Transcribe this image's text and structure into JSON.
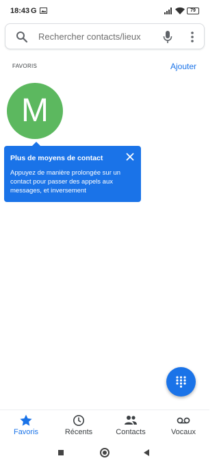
{
  "status_bar": {
    "time": "18:43",
    "g_label": "G",
    "battery": "79",
    "icons": [
      "google-icon",
      "gallery-icon",
      "signal-icon",
      "wifi-icon",
      "battery-icon"
    ]
  },
  "search": {
    "placeholder": "Rechercher contacts/lieux",
    "icons": [
      "search-icon",
      "mic-icon",
      "more-vert-icon"
    ]
  },
  "favorites": {
    "heading": "FAVORIS",
    "add_label": "Ajouter",
    "contacts": [
      {
        "initial": "M",
        "color": "#5cb85f"
      }
    ]
  },
  "tooltip": {
    "title": "Plus de moyens de contact",
    "body": "Appuyez de manière prolongée sur un contact pour passer des appels aux messages, et inversement",
    "icon": "close-icon",
    "color": "#1a73e8"
  },
  "fab": {
    "icon": "dialpad-icon"
  },
  "bottom_nav": {
    "items": [
      {
        "label": "Favoris",
        "icon": "star-icon",
        "active": true
      },
      {
        "label": "Récents",
        "icon": "clock-icon",
        "active": false
      },
      {
        "label": "Contacts",
        "icon": "people-icon",
        "active": false
      },
      {
        "label": "Vocaux",
        "icon": "voicemail-icon",
        "active": false
      }
    ]
  },
  "theme": {
    "accent": "#1a73e8",
    "text": "#3c4043"
  }
}
